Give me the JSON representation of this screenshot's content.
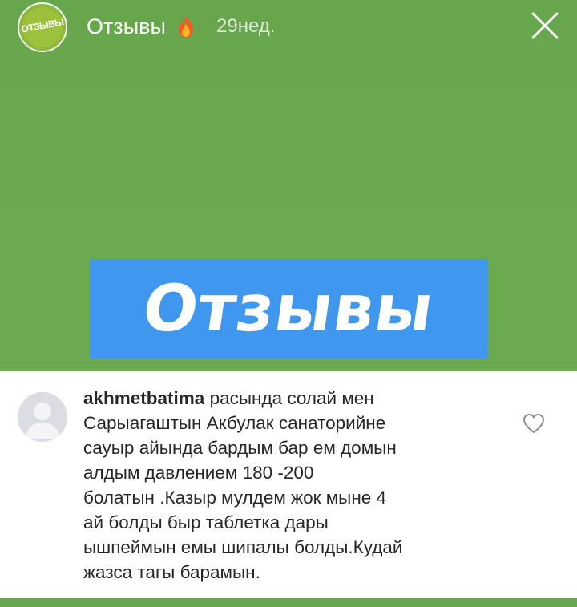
{
  "header": {
    "avatar_label": "ОТЗЫВЫ",
    "account_name": "Отзывы",
    "fire_icon": "fire-emoji",
    "time_ago": "29нед.",
    "close_icon": "close-icon"
  },
  "banner": {
    "title": "Отзывы",
    "background_color": "#3f97ee"
  },
  "comment": {
    "username": "akhmetbatima",
    "first_line_text": " расында солай мен",
    "lines": [
      "Сарыагаштын Акбулак санаторийне",
      "сауыр айында бардым бар ем домын",
      "алдым давлением 180 -200",
      "болатын .Казыр мулдем жок мыне 4",
      "ай болды быр таблетка дары",
      "ышпеймын емы шипалы болды.Кудай",
      "жазса тагы барамын."
    ],
    "like_icon": "heart-outline-icon"
  },
  "colors": {
    "story_background": "#6aa84f",
    "banner_blue": "#3f97ee",
    "avatar_green": "#8db83a"
  }
}
